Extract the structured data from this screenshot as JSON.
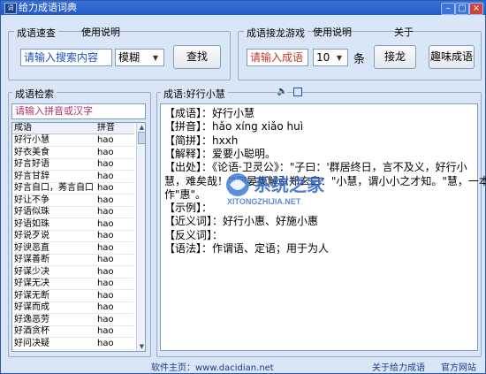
{
  "window": {
    "title": "给力成语词典",
    "app_icon": "app-icon"
  },
  "quick_query": {
    "group_title": "成语速查",
    "usage_label": "使用说明",
    "search_placeholder": "请输入搜索内容",
    "mode_value": "模糊",
    "search_button": "查找"
  },
  "solitaire": {
    "group_title": "成语接龙游戏",
    "usage_label": "使用说明",
    "about_label": "关于",
    "input_placeholder": "请输入成语",
    "count_value": "10",
    "count_unit": "条",
    "play_button": "接龙",
    "fun_button": "趣味成语"
  },
  "search_panel": {
    "group_title": "成语检索",
    "filter_placeholder": "请输入拼音或汉字",
    "columns": [
      "成语",
      "拼音"
    ],
    "rows": [
      [
        "好行小慧",
        "hao"
      ],
      [
        "好衣美食",
        "hao"
      ],
      [
        "好言好语",
        "hao"
      ],
      [
        "好言甘辞",
        "hao"
      ],
      [
        "好言自口，莠言自口",
        "hao"
      ],
      [
        "好让不争",
        "hao"
      ],
      [
        "好语似珠",
        "hao"
      ],
      [
        "好语如珠",
        "hao"
      ],
      [
        "好说歹说",
        "hao"
      ],
      [
        "好谀恶直",
        "hao"
      ],
      [
        "好谋善断",
        "hao"
      ],
      [
        "好谋少决",
        "hao"
      ],
      [
        "好谋无决",
        "hao"
      ],
      [
        "好谋无断",
        "hao"
      ],
      [
        "好谋而成",
        "hao"
      ],
      [
        "好逸恶劳",
        "hao"
      ],
      [
        "好酒贪杯",
        "hao"
      ],
      [
        "好问决疑",
        "hao"
      ]
    ]
  },
  "detail": {
    "group_title": "成语:好行小慧",
    "lines": [
      "【成语】：好行小慧",
      "【拼音】：hǎo xíng xiǎo huì",
      "【简拼】：hxxh",
      "【解释】：爱要小聪明。",
      "【出处】：《论语·卫灵公》：\"子曰：'群居终日，言不及义，好行小",
      "慧，难矣哉！'\"何晏集解引郑玄曰：\"小慧，谓小小之才知。\"慧，一本",
      "作\"惠\"。",
      "【示例】：",
      "【近义词】：好行小惠、好施小惠",
      "【反义词】：",
      "【语法】：作谓语、定语；用于为人"
    ]
  },
  "watermark": {
    "brand": "系统之家",
    "url": "XITONGZHIJIA.NET"
  },
  "footer": {
    "homepage": "软件主页：www.dacidian.net",
    "about": "关于给力成语",
    "official": "官方网站"
  },
  "colors": {
    "accent": "#2c5aa8",
    "placeholder_blue": "#1f4fbf",
    "placeholder_red": "#c0392b",
    "link": "#1a3a8a"
  }
}
